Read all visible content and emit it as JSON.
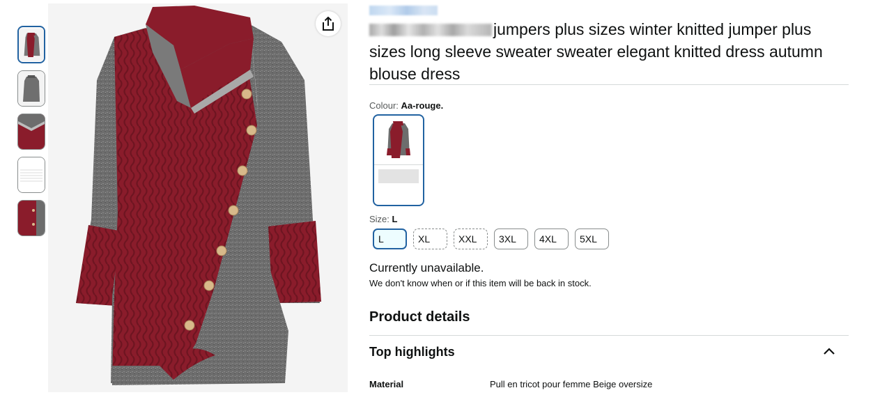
{
  "product": {
    "title_visible": "jumpers plus sizes winter knitted jumper plus sizes long sleeve sweater sweater elegant knitted dress autumn blouse dress"
  },
  "colour": {
    "label": "Colour:",
    "value": "Aa-rouge."
  },
  "size": {
    "label": "Size:",
    "value": "L",
    "options": [
      "L",
      "XL",
      "XXL",
      "3XL",
      "4XL",
      "5XL"
    ]
  },
  "availability": {
    "status": "Currently unavailable.",
    "note": "We don't know when or if this item will be back in stock."
  },
  "details": {
    "heading": "Product details",
    "highlights_heading": "Top highlights",
    "specs": [
      {
        "key": "Material",
        "value": "Pull en tricot pour femme Beige oversize"
      }
    ]
  },
  "icons": {
    "share": "share-icon",
    "collapse": "chevron-up-icon"
  },
  "colors": {
    "accent": "#2162a1",
    "burgundy": "#8a1c2b",
    "heather": "#6b6b6b"
  }
}
